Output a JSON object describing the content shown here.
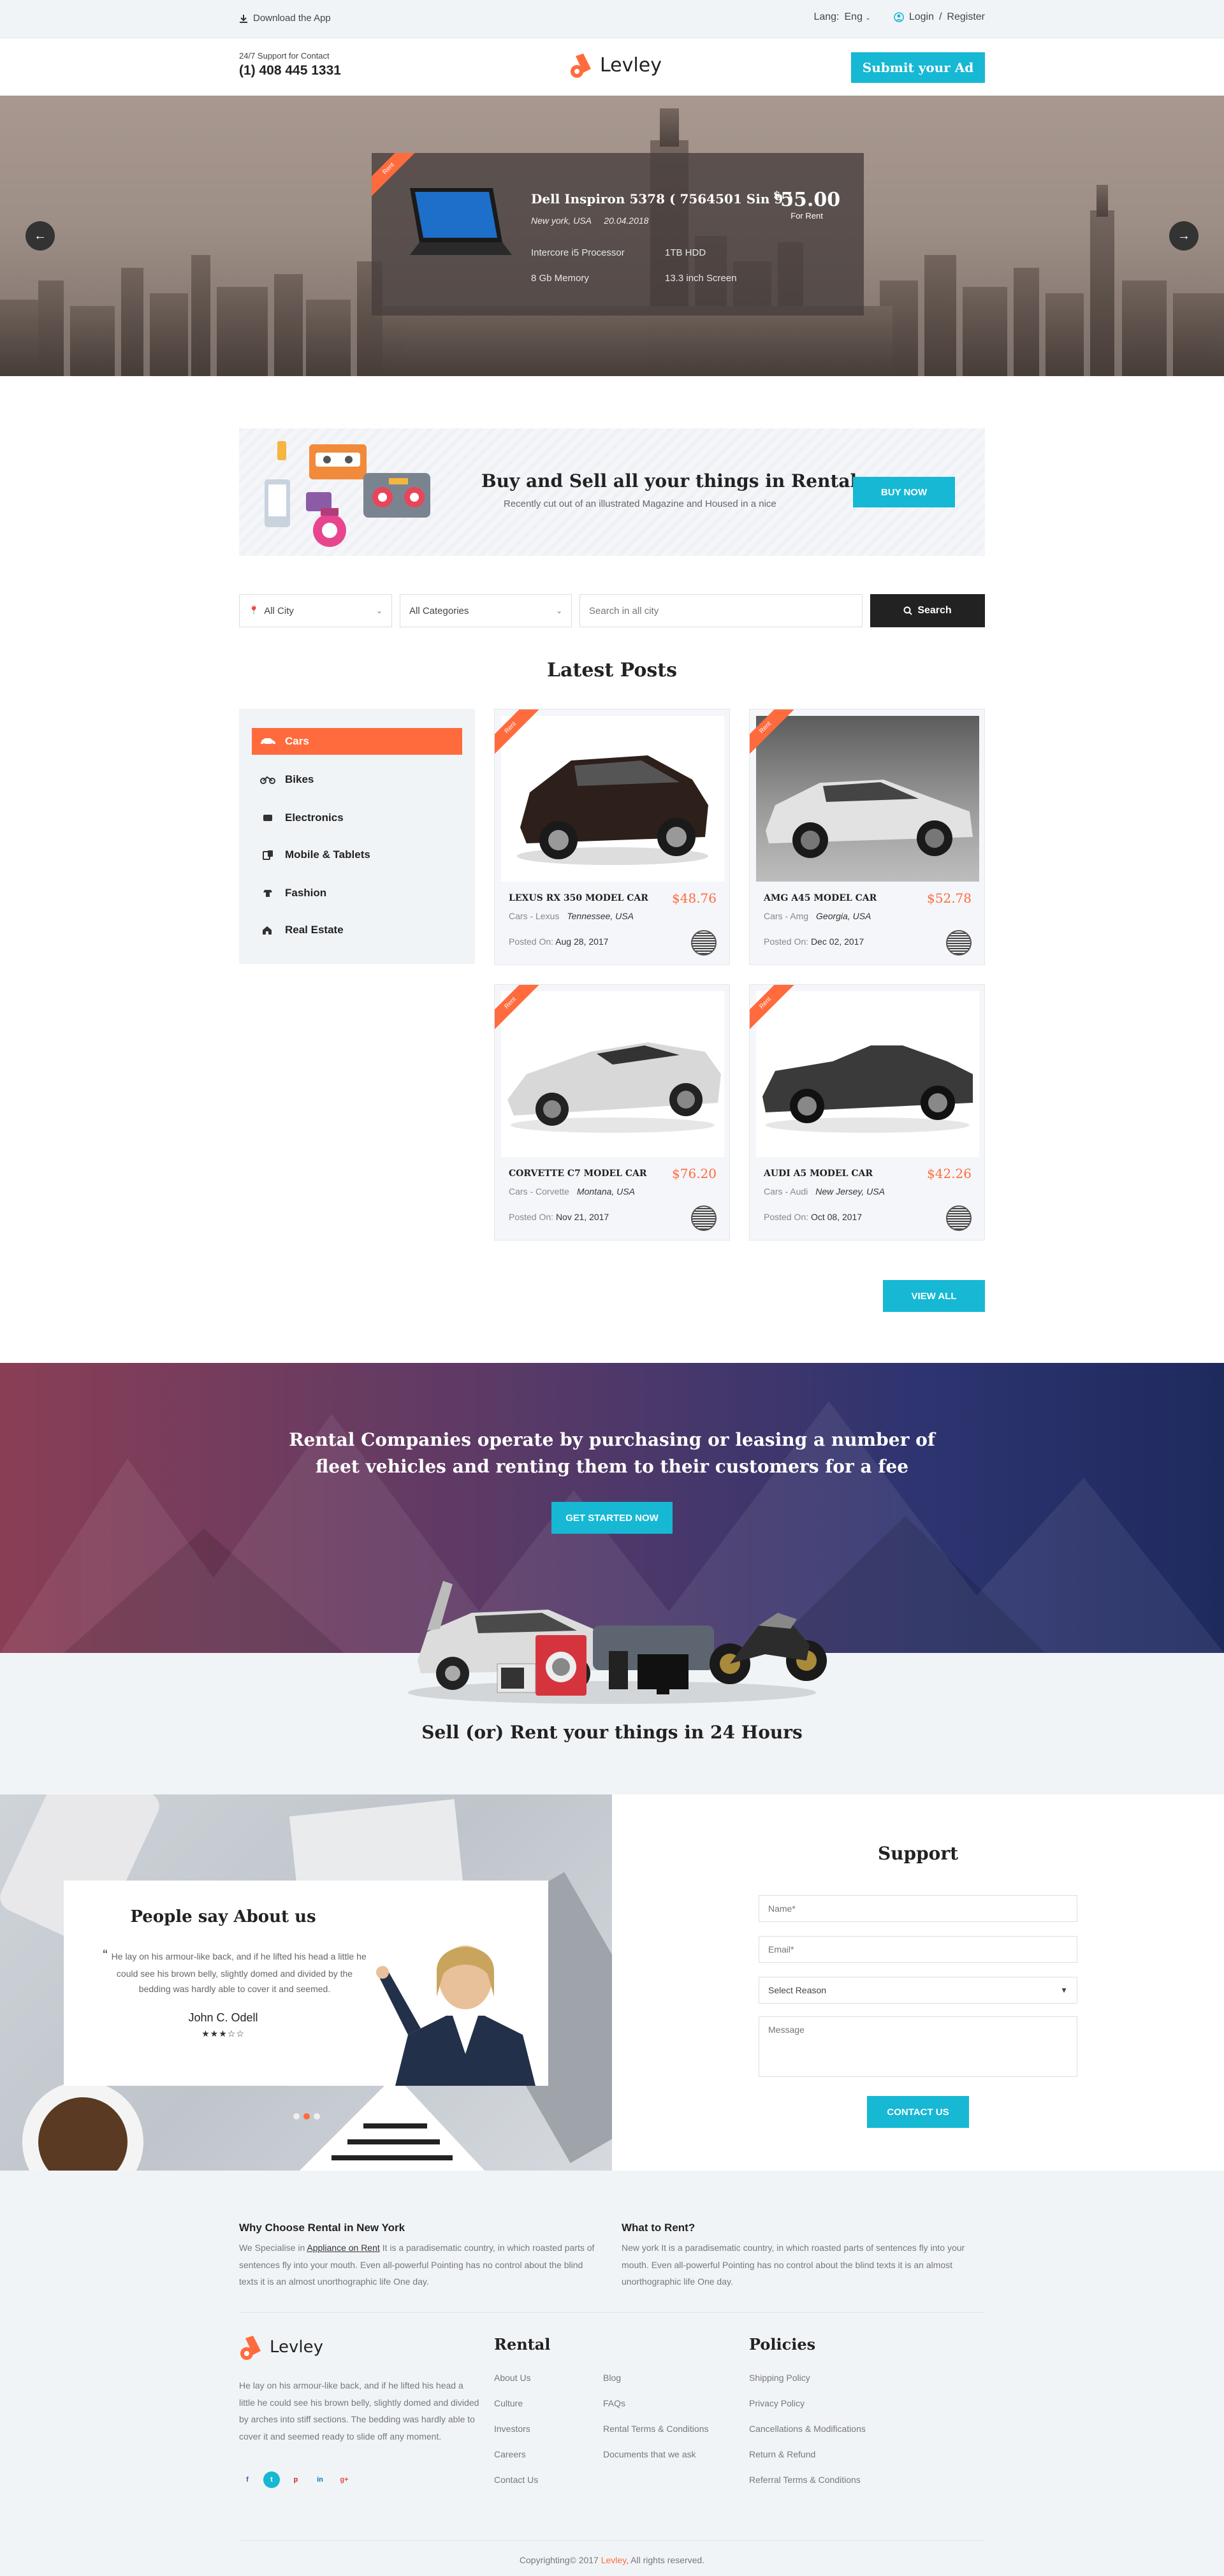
{
  "topbar": {
    "download": "Download the App",
    "lang_label": "Lang:",
    "lang_value": "Eng",
    "login": "Login",
    "sep": "/",
    "register": "Register"
  },
  "header": {
    "support_label": "24/7 Support for Contact",
    "phone": "(1) 408 445 1331",
    "logo_text": "Levley",
    "submit_btn": "Submit your Ad"
  },
  "hero": {
    "ribbon": "Rent",
    "title": "Dell Inspiron 5378 ( 7564501 Sin 9 )",
    "location": "New york, USA",
    "date": "20.04.2018",
    "currency": "$",
    "price": "55.00",
    "price_note": "For Rent",
    "specs": [
      "Intercore i5 Processor",
      "1TB HDD",
      "8 Gb Memory",
      "13.3 inch Screen"
    ],
    "prev": "←",
    "next": "→"
  },
  "banner": {
    "title": "Buy and Sell all your things in Rental.com",
    "subtitle": "Recently cut out of an illustrated Magazine and Housed in a nice",
    "button": "BUY NOW"
  },
  "search": {
    "city": "All City",
    "category": "All Categories",
    "placeholder": "Search in all city",
    "button": "Search"
  },
  "latest": {
    "title": "Latest Posts",
    "categories": [
      {
        "label": "Cars",
        "icon": "car-icon"
      },
      {
        "label": "Bikes",
        "icon": "bike-icon"
      },
      {
        "label": "Electronics",
        "icon": "electronics-icon"
      },
      {
        "label": "Mobile & Tablets",
        "icon": "mobile-icon"
      },
      {
        "label": "Fashion",
        "icon": "fashion-icon"
      },
      {
        "label": "Real Estate",
        "icon": "real-estate-icon"
      }
    ],
    "posts": [
      {
        "ribbon": "Rent",
        "title": "LEXUS RX 350 MODEL CAR",
        "price": "$48.76",
        "brand": "Cars - Lexus",
        "location": "Tennessee, USA",
        "posted_label": "Posted On:",
        "date": "Aug 28, 2017"
      },
      {
        "ribbon": "Rent",
        "title": "AMG A45 MODEL CAR",
        "price": "$52.78",
        "brand": "Cars - Amg",
        "location": "Georgia, USA",
        "posted_label": "Posted On:",
        "date": "Dec 02, 2017"
      },
      {
        "ribbon": "Rent",
        "title": "CORVETTE C7 MODEL CAR",
        "price": "$76.20",
        "brand": "Cars - Corvette",
        "location": "Montana, USA",
        "posted_label": "Posted On:",
        "date": "Nov 21, 2017"
      },
      {
        "ribbon": "Rent",
        "title": "AUDI A5 MODEL CAR",
        "price": "$42.26",
        "brand": "Cars - Audi",
        "location": "New Jersey, USA",
        "posted_label": "Posted On:",
        "date": "Oct 08, 2017"
      }
    ],
    "view_all": "VIEW ALL"
  },
  "rental": {
    "line1": "Rental Companies operate by purchasing or leasing a number of",
    "line2": "fleet vehicles and renting them to their customers for a fee",
    "button": "GET STARTED NOW"
  },
  "sell": {
    "title": "Sell (or) Rent your things in 24 Hours"
  },
  "testimonial": {
    "title": "People say About us",
    "quote_mark": "“",
    "quote": "He lay on his armour-like back, and if he lifted his head a little he could see his brown belly, slightly domed and divided by the bedding was hardly able to cover it and seemed.",
    "name": "John C. Odell",
    "stars": "★★★☆☆"
  },
  "support": {
    "title": "Support",
    "name_ph": "Name*",
    "email_ph": "Email*",
    "reason": "Select Reason",
    "message_ph": "Message",
    "button": "CONTACT US"
  },
  "footer": {
    "why_title": "Why Choose Rental in New York",
    "why_pre": "We Specialise in ",
    "why_link": "Appliance on Rent",
    "why_text": " It is a paradisematic country, in which roasted parts of sentences fly into your mouth. Even all-powerful Pointing has no control about the blind texts it is an almost unorthographic life One day.",
    "what_title": "What to Rent?",
    "what_text": "New york It is a paradisematic country, in which roasted parts of sentences fly into your mouth. Even all-powerful Pointing has no control about the blind texts it is an almost unorthographic life One day.",
    "logo_text": "Levley",
    "about": "He lay on his armour-like back, and if he lifted his head a little he could see his brown belly, slightly domed and divided by arches into stiff sections. The bedding was hardly able to cover it and seemed ready to slide off any moment.",
    "social": [
      "f",
      "t",
      "p",
      "in",
      "g+"
    ],
    "rental_title": "Rental",
    "rental_col1": [
      "About Us",
      "Culture",
      "Investors",
      "Careers",
      "Contact Us"
    ],
    "rental_col2": [
      "Blog",
      "FAQs",
      "Rental Terms & Conditions",
      "Documents that we ask"
    ],
    "policies_title": "Policies",
    "policies": [
      "Shipping Policy",
      "Privacy Policy",
      "Cancellations & Modifications",
      "Return & Refund",
      "Referral Terms & Conditions"
    ],
    "copy_pre": "Copyrighting© 2017 ",
    "copy_brand": "Levley",
    "copy_post": ", All rights reserved."
  },
  "colors": {
    "accent": "#16b8d4",
    "orange": "#ff6b3d",
    "dark": "#222222"
  }
}
